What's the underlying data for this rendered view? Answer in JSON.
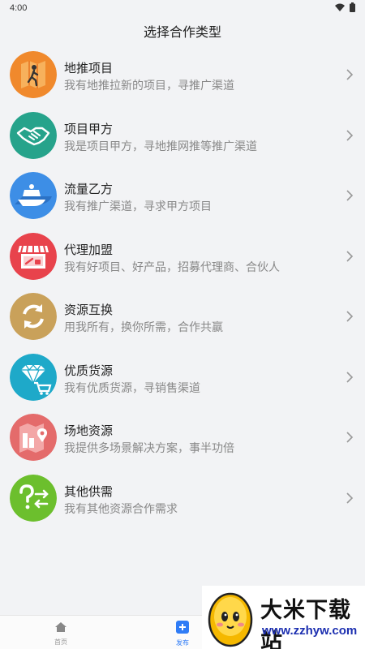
{
  "status_bar": {
    "time": "4:00"
  },
  "header": {
    "title": "选择合作类型"
  },
  "items": [
    {
      "title": "地推项目",
      "desc": "我有地推拉新的项目，寻推广渠道",
      "icon": "map-walker-icon",
      "color": "#f0892c"
    },
    {
      "title": "项目甲方",
      "desc": "我是项目甲方，寻地推网推等推广渠道",
      "icon": "handshake-icon",
      "color": "#26a38b"
    },
    {
      "title": "流量乙方",
      "desc": "我有推广渠道，寻求甲方项目",
      "icon": "boat-icon",
      "color": "#3d8ee6"
    },
    {
      "title": "代理加盟",
      "desc": "我有好项目、好产品，招募代理商、合伙人",
      "icon": "shop-icon",
      "color": "#e8434c"
    },
    {
      "title": "资源互换",
      "desc": "用我所有，换你所需，合作共赢",
      "icon": "exchange-icon",
      "color": "#c9a15a"
    },
    {
      "title": "优质货源",
      "desc": "我有优质货源，寻销售渠道",
      "icon": "diamond-cart-icon",
      "color": "#1ea9c9"
    },
    {
      "title": "场地资源",
      "desc": "我提供多场景解决方案，事半功倍",
      "icon": "venue-map-icon",
      "color": "#e46b6b"
    },
    {
      "title": "其他供需",
      "desc": "我有其他资源合作需求",
      "icon": "question-arrows-icon",
      "color": "#6cbf2d"
    }
  ],
  "tabbar": {
    "home_label": "首页",
    "publish_label": "发布",
    "active_color": "#2f7cf6"
  },
  "watermark": {
    "name": "大米下载站",
    "url": "www.zzhyw.com"
  }
}
